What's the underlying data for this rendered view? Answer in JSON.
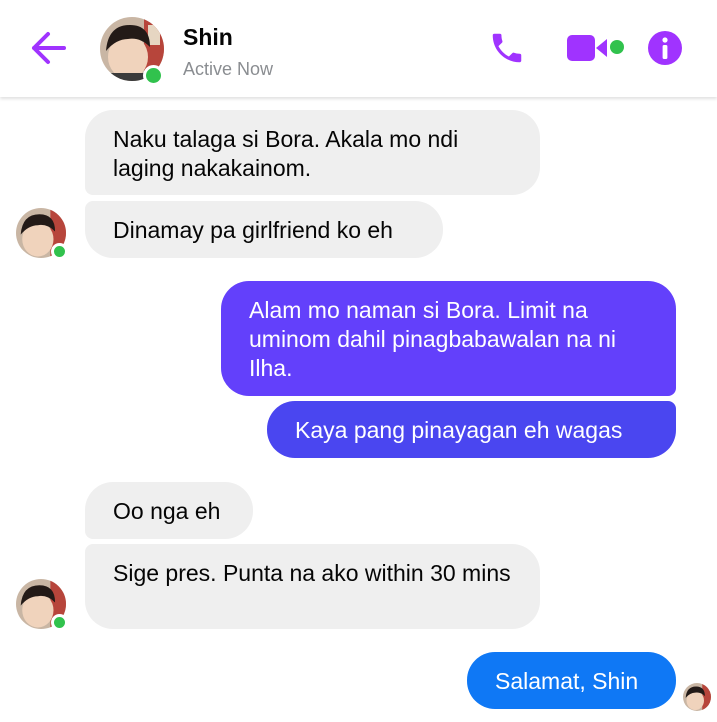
{
  "header": {
    "contact_name": "Shin",
    "status": "Active Now",
    "icons": {
      "back": "back-arrow-icon",
      "call": "phone-icon",
      "video": "video-camera-icon",
      "info": "info-icon"
    }
  },
  "colors": {
    "accent": "#a033ff",
    "online": "#31c24d",
    "incoming_bubble": "#efefef",
    "outgoing_top": "#7a3cff",
    "outgoing_mid": "#4a46f0",
    "outgoing_bottom": "#0f78f5"
  },
  "messages": [
    {
      "direction": "in",
      "text": "Naku talaga si Bora. Akala mo ndi laging nakakainom."
    },
    {
      "direction": "in",
      "text": "Dinamay pa girlfriend ko eh"
    },
    {
      "direction": "out",
      "text": "Alam mo naman si Bora. Limit na uminom dahil pinagbabawalan na ni Ilha."
    },
    {
      "direction": "out",
      "text": "Kaya pang pinayagan eh wagas"
    },
    {
      "direction": "in",
      "text": "Oo nga eh"
    },
    {
      "direction": "in",
      "text": "Sige pres. Punta na ako within 30 mins"
    },
    {
      "direction": "out",
      "text": "Salamat, Shin"
    }
  ]
}
